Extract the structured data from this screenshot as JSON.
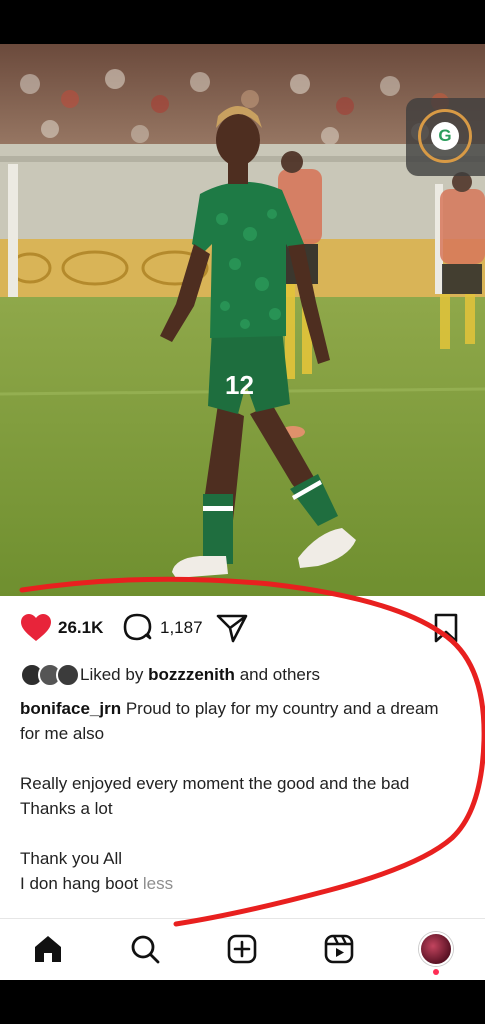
{
  "post": {
    "likes_count": "26.1K",
    "comments_count": "1,187",
    "liked_by_prefix": "Liked by",
    "liked_by_user": "bozzzenith",
    "liked_by_suffix": "and others",
    "username": "boniface_jrn",
    "caption_line1": "Proud to play for my country and a dream for me also",
    "caption_line2": "Really enjoyed every moment the good and the bad",
    "caption_line3": "Thanks a lot",
    "caption_line4": "Thank you All",
    "caption_line5": "I don hang boot",
    "less_label": "less",
    "jersey_number": "12"
  },
  "icons": {
    "like": "heart-icon",
    "comment": "comment-icon",
    "share": "share-icon",
    "save": "bookmark-icon",
    "home": "home-icon",
    "search": "search-icon",
    "create": "create-icon",
    "reels": "reels-icon",
    "overlay": "floating-app-icon"
  },
  "colors": {
    "like": "#e8243a",
    "annotation": "#e8201f",
    "kit_green": "#1e7a45"
  }
}
